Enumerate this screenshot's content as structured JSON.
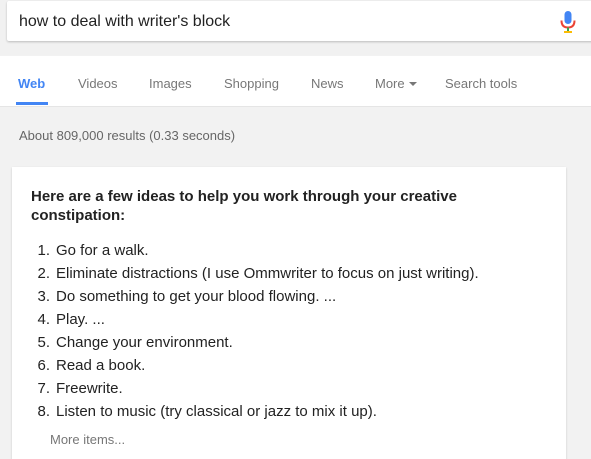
{
  "search": {
    "query": "how to deal with writer's block"
  },
  "tabs": [
    {
      "label": "Web",
      "active": true
    },
    {
      "label": "Videos"
    },
    {
      "label": "Images"
    },
    {
      "label": "Shopping"
    },
    {
      "label": "News"
    },
    {
      "label": "More"
    },
    {
      "label": "Search tools"
    }
  ],
  "result_stats": "About 809,000 results (0.33 seconds)",
  "featured_snippet": {
    "heading": "Here are a few ideas to help you work through your creative constipation:",
    "items": [
      {
        "num": "1.",
        "text": "Go for a walk."
      },
      {
        "num": "2.",
        "text": "Eliminate distractions (I use Ommwriter to focus on just writing)."
      },
      {
        "num": "3.",
        "text": "Do something to get your blood flowing. ..."
      },
      {
        "num": "4.",
        "text": "Play. ..."
      },
      {
        "num": "5.",
        "text": "Change your environment."
      },
      {
        "num": "6.",
        "text": "Read a book."
      },
      {
        "num": "7.",
        "text": "Freewrite."
      },
      {
        "num": "8.",
        "text": "Listen to music (try classical or jazz to mix it up)."
      }
    ],
    "more_label": "More items..."
  },
  "icons": {
    "mic": "microphone-icon",
    "more_caret": "caret-down-icon"
  },
  "colors": {
    "accent_blue": "#4285f4",
    "mic_red": "#ea4335",
    "text_dark": "#222222",
    "text_muted": "#777777"
  }
}
